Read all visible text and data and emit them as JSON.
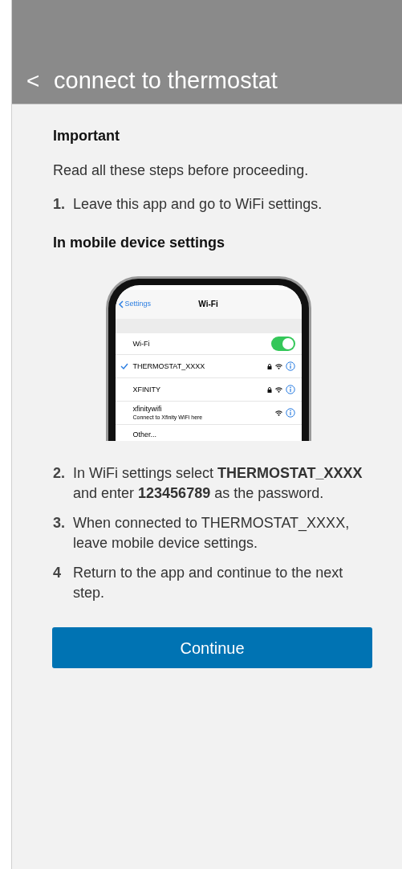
{
  "header": {
    "back_icon": "<",
    "title": "connect to thermostat"
  },
  "heading": "Important",
  "intro": "Read all these steps before proceeding.",
  "steps_before": [
    {
      "number": "1.",
      "text": "Leave this app and go to WiFi settings."
    }
  ],
  "subheading": "In mobile device settings",
  "phone_screenshot": {
    "back_label": "Settings",
    "title": "Wi-Fi",
    "wifi_row": {
      "label": "Wi-Fi",
      "on": true
    },
    "networks": [
      {
        "name": "THERMOSTAT_XXXX",
        "selected": true,
        "locked": true
      },
      {
        "name": "XFINITY",
        "selected": false,
        "locked": true
      },
      {
        "name": "xfinitywifi",
        "subtitle": "Connect to Xfinity WiFi here",
        "selected": false,
        "locked": false
      }
    ],
    "other": "Other..."
  },
  "steps_after": [
    {
      "number": "2.",
      "text": "In WiFi settings select **THERMOSTAT_XXXX** and enter **123456789** as the password."
    },
    {
      "number": "3.",
      "text": "When connected to THERMOSTAT_XXXX, leave mobile device settings."
    },
    {
      "number": "4",
      "text": "Return to the app and continue to the next step."
    }
  ],
  "continue_button": "Continue"
}
